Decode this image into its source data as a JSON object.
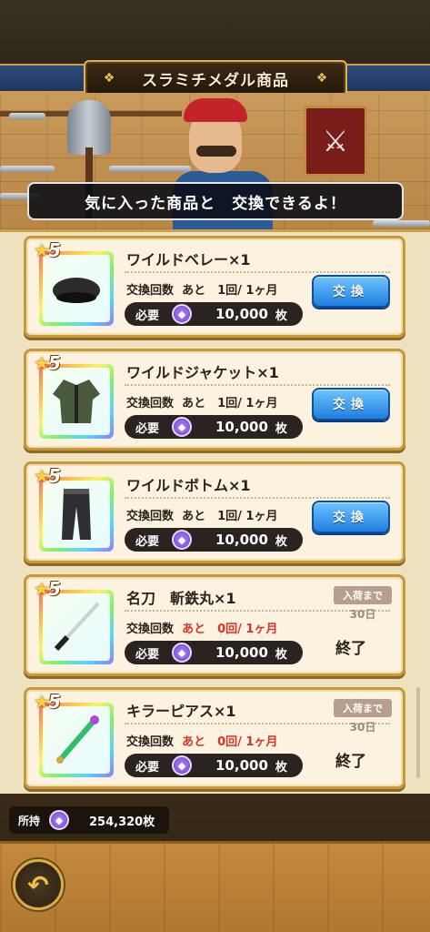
{
  "header": {
    "title": "スラミチメダル商品"
  },
  "scene": {
    "speech": "気に入った商品と　交換できるよ！"
  },
  "items": [
    {
      "rank": "5",
      "name": "ワイルドベレー×1",
      "count_label": "交換回数",
      "count_remaining": "あと　1回/ 1ヶ月",
      "cost_label": "必要",
      "cost": "10,000",
      "unit": "枚",
      "action": "交換",
      "state": "available",
      "icon": "beret-icon"
    },
    {
      "rank": "5",
      "name": "ワイルドジャケット×1",
      "count_label": "交換回数",
      "count_remaining": "あと　1回/ 1ヶ月",
      "cost_label": "必要",
      "cost": "10,000",
      "unit": "枚",
      "action": "交換",
      "state": "available",
      "icon": "jacket-icon"
    },
    {
      "rank": "5",
      "name": "ワイルドボトム×1",
      "count_label": "交換回数",
      "count_remaining": "あと　1回/ 1ヶ月",
      "cost_label": "必要",
      "cost": "10,000",
      "unit": "枚",
      "action": "交換",
      "state": "available",
      "icon": "pants-icon"
    },
    {
      "rank": "5",
      "name": "名刀　斬鉄丸×1",
      "count_label": "交換回数",
      "count_remaining": "あと　0回/ 1ヶ月",
      "cost_label": "必要",
      "cost": "10,000",
      "unit": "枚",
      "restock_label": "入荷まで",
      "restock_days": "30日",
      "ended": "終了",
      "state": "sold_out",
      "icon": "katana-icon"
    },
    {
      "rank": "5",
      "name": "キラーピアス×1",
      "count_label": "交換回数",
      "count_remaining": "あと　0回/ 1ヶ月",
      "cost_label": "必要",
      "cost": "10,000",
      "unit": "枚",
      "restock_label": "入荷まで",
      "restock_days": "30日",
      "ended": "終了",
      "state": "sold_out",
      "icon": "dagger-icon"
    }
  ],
  "footer": {
    "owned_label": "所持",
    "owned_value": "254,320枚",
    "back_icon": "back-arrow-icon"
  },
  "colors": {
    "accent_gold": "#c69a3a",
    "button_blue": "#1f7fe0",
    "sold_out_red": "#d6332b"
  }
}
